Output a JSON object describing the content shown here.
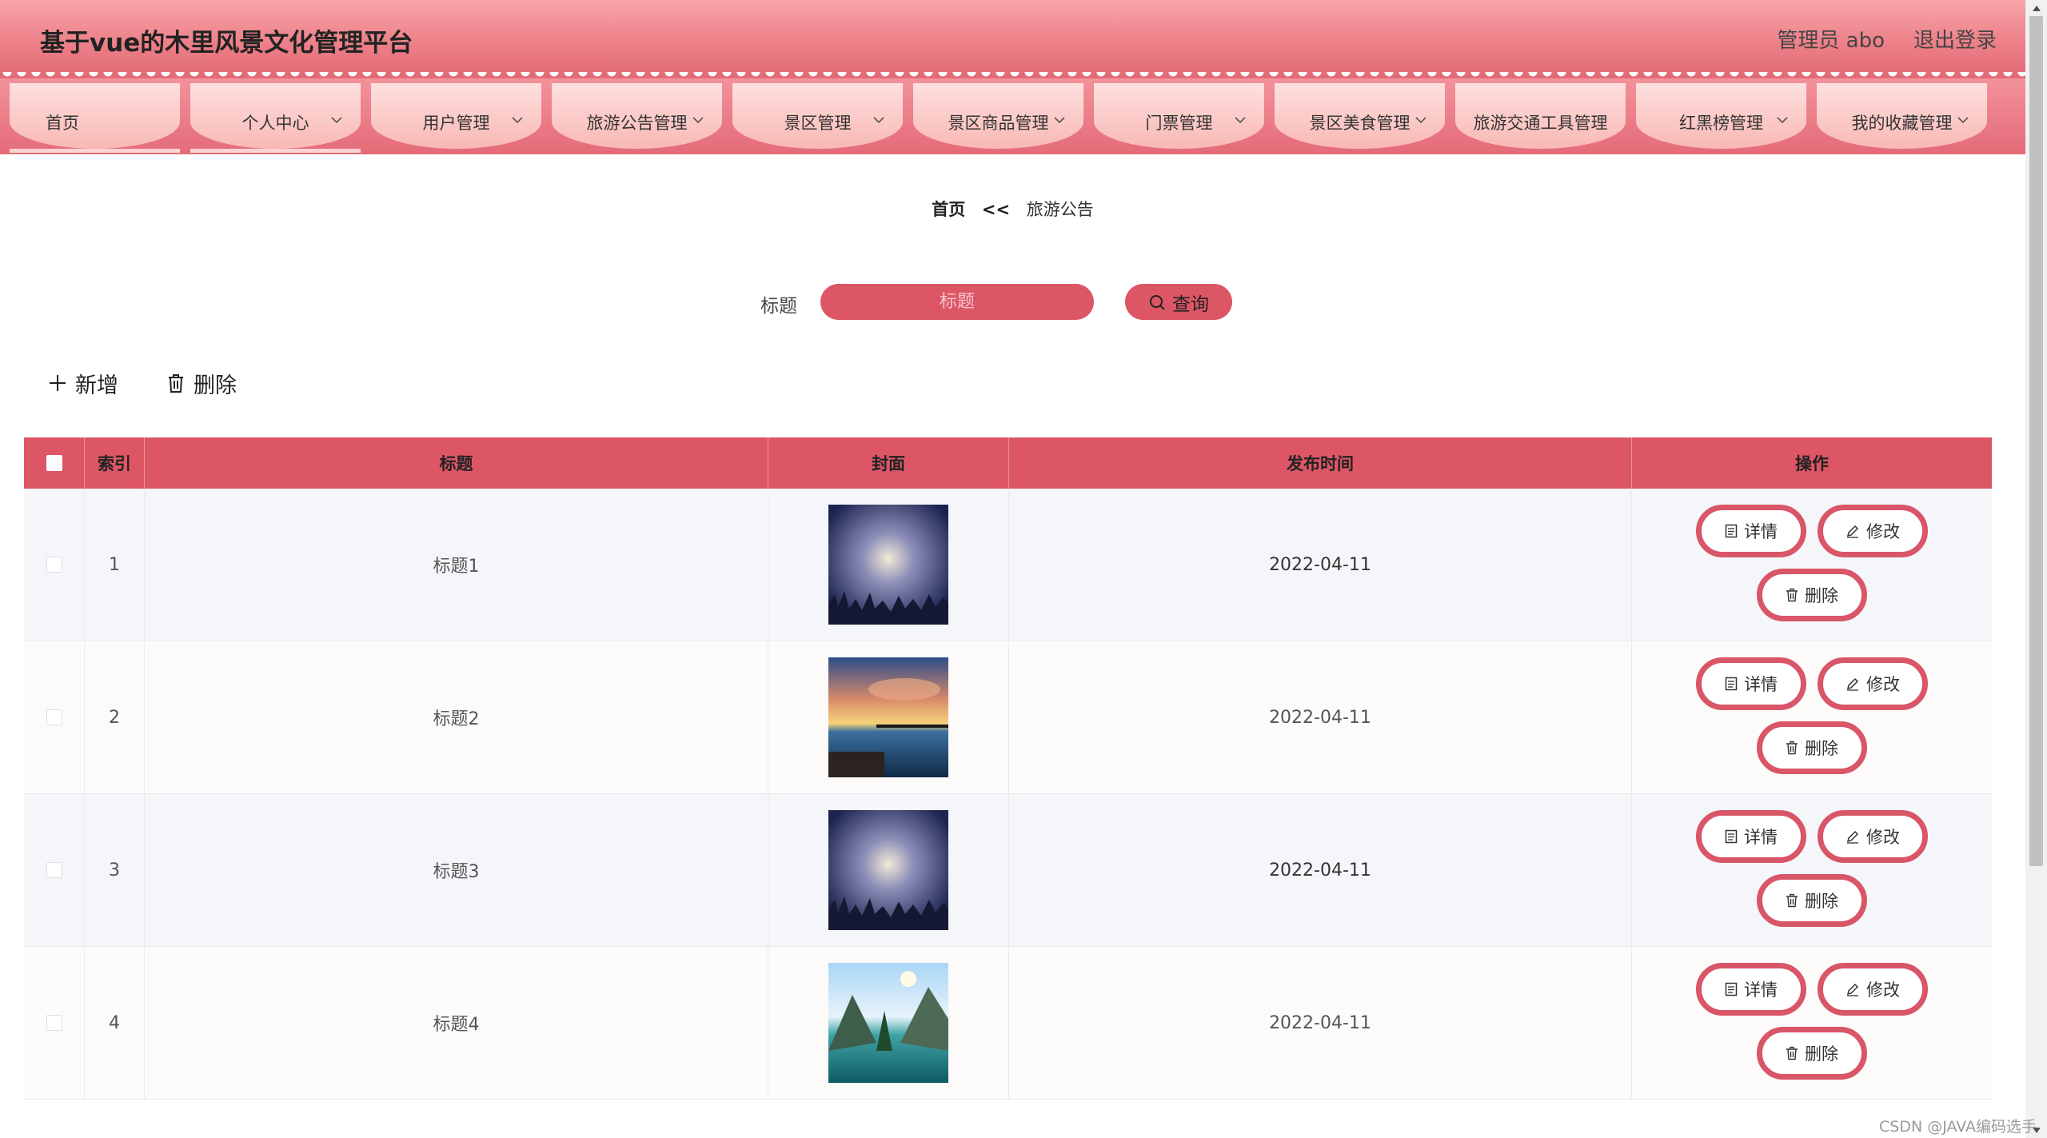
{
  "header": {
    "title": "基于vue的木里风景文化管理平台",
    "user_label": "管理员 abo",
    "logout_label": "退出登录"
  },
  "nav": {
    "items": [
      {
        "label": "首页",
        "has_dropdown": false
      },
      {
        "label": "个人中心",
        "has_dropdown": true
      },
      {
        "label": "用户管理",
        "has_dropdown": true
      },
      {
        "label": "旅游公告管理",
        "has_dropdown": true
      },
      {
        "label": "景区管理",
        "has_dropdown": true
      },
      {
        "label": "景区商品管理",
        "has_dropdown": true
      },
      {
        "label": "门票管理",
        "has_dropdown": true
      },
      {
        "label": "景区美食管理",
        "has_dropdown": true
      },
      {
        "label": "旅游交通工具管理",
        "has_dropdown": false
      },
      {
        "label": "红黑榜管理",
        "has_dropdown": true
      },
      {
        "label": "我的收藏管理",
        "has_dropdown": true
      }
    ]
  },
  "breadcrumb": {
    "home": "首页",
    "separator": "<<",
    "current": "旅游公告"
  },
  "search": {
    "label": "标题",
    "placeholder": "标题",
    "button_label": "查询"
  },
  "toolbar": {
    "add_label": "新增",
    "delete_label": "删除"
  },
  "table": {
    "columns": [
      "索引",
      "标题",
      "封面",
      "发布时间",
      "操作"
    ],
    "rows": [
      {
        "index": "1",
        "title": "标题1",
        "cover": "night-sky-grass",
        "time": "2022-04-11"
      },
      {
        "index": "2",
        "title": "标题2",
        "cover": "sunset-pier",
        "time": "2022-04-11"
      },
      {
        "index": "3",
        "title": "标题3",
        "cover": "night-sky-grass",
        "time": "2022-04-11"
      },
      {
        "index": "4",
        "title": "标题4",
        "cover": "mountain-lake",
        "time": "2022-04-11"
      }
    ],
    "actions": {
      "detail_label": "详情",
      "edit_label": "修改",
      "delete_label": "删除"
    }
  },
  "watermark": "CSDN @JAVA编码选手",
  "colors": {
    "accent": "#dd5666",
    "header_top": "#f6a5a8",
    "nav_tab": "#fbd0cd"
  }
}
